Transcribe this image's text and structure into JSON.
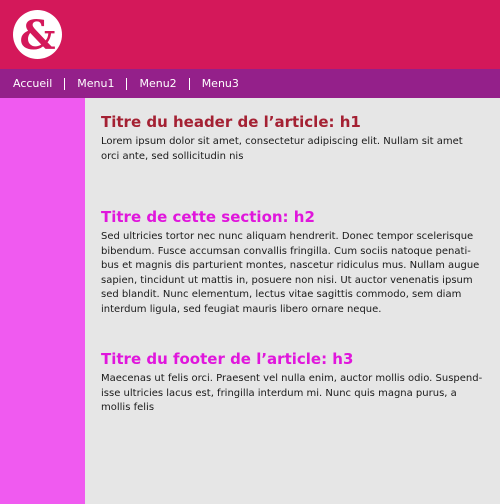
{
  "brand": {
    "logo_glyph": "&",
    "primary_color": "#d4185a",
    "nav_color": "#94208a",
    "sidebar_color": "#f05af0"
  },
  "nav": {
    "items": [
      "Accueil",
      "Menu1",
      "Menu2",
      "Menu3"
    ]
  },
  "article": {
    "header": {
      "title": "Titre du header de l’article: h1",
      "lines": [
        "Lorem ipsum dolor sit amet, consectetur adipiscing elit. Nullam sit amet",
        "orci ante, sed sollicitudin nis"
      ]
    },
    "section": {
      "title": "Titre de cette section: h2",
      "lines": [
        "Sed ultricies tortor nec nunc aliquam hendrerit. Donec tempor scelerisque",
        "bibendum. Fusce accumsan convallis fringilla. Cum sociis natoque penati-",
        "bus et magnis dis parturient montes, nascetur ridiculus mus. Nullam augue",
        "sapien, tincidunt ut mattis in, posuere non nisi. Ut auctor venenatis ipsum",
        "sed blandit. Nunc elementum, lectus vitae sagittis commodo, sem diam",
        "interdum ligula, sed feugiat mauris libero ornare neque."
      ]
    },
    "footer": {
      "title": "Titre du footer de l’article: h3",
      "lines": [
        "Maecenas ut felis orci. Praesent vel nulla enim, auctor mollis odio. Suspend-",
        "isse ultricies lacus est, fringilla interdum mi. Nunc quis magna purus, a",
        "mollis felis"
      ]
    }
  }
}
